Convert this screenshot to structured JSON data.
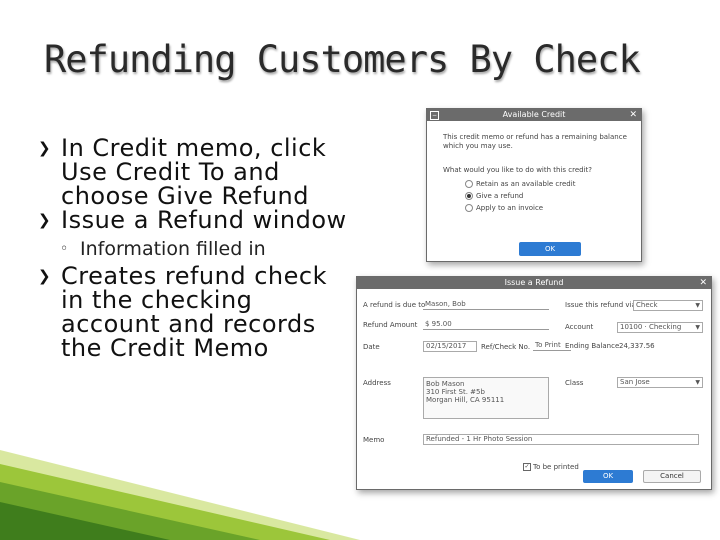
{
  "slide": {
    "title": "Refunding Customers By Check",
    "bullets": [
      "In Credit memo, click Use Credit To and choose Give Refund",
      "Issue a Refund window",
      "Creates refund check in the checking account and records the Credit Memo"
    ],
    "sub_bullet": "Information filled in"
  },
  "icons": {
    "bullet": "arrow-bullet-icon",
    "sub_bullet": "circle-bullet-icon"
  },
  "available_credit": {
    "title": "Available Credit",
    "message": "This credit memo or refund has a remaining balance which you may use.",
    "question": "What would you like to do with this credit?",
    "options": [
      "Retain as an available credit",
      "Give a refund",
      "Apply to an invoice"
    ],
    "selected_index": 1,
    "ok": "OK"
  },
  "issue_refund": {
    "title": "Issue a Refund",
    "refund_due_label": "A refund is due to",
    "refund_due_value": "Mason, Bob",
    "amount_label": "Refund Amount",
    "amount_value": "$ 95.00",
    "date_label": "Date",
    "date_value": "02/15/2017",
    "refcheck_label": "Ref/Check No.",
    "refcheck_value": "To Print",
    "address_label": "Address",
    "address_lines": [
      "Bob Mason",
      "310 First St. #5b",
      "Morgan Hill, CA 95111"
    ],
    "memo_label": "Memo",
    "memo_value": "Refunded - 1 Hr Photo Session",
    "issue_via_label": "Issue this refund via",
    "issue_via_value": "Check",
    "account_label": "Account",
    "account_value": "10100 · Checking",
    "ending_balance_label": "Ending Balance",
    "ending_balance_value": "24,337.56",
    "class_label": "Class",
    "class_value": "San Jose",
    "to_be_printed": "To be printed",
    "ok": "OK",
    "cancel": "Cancel"
  }
}
